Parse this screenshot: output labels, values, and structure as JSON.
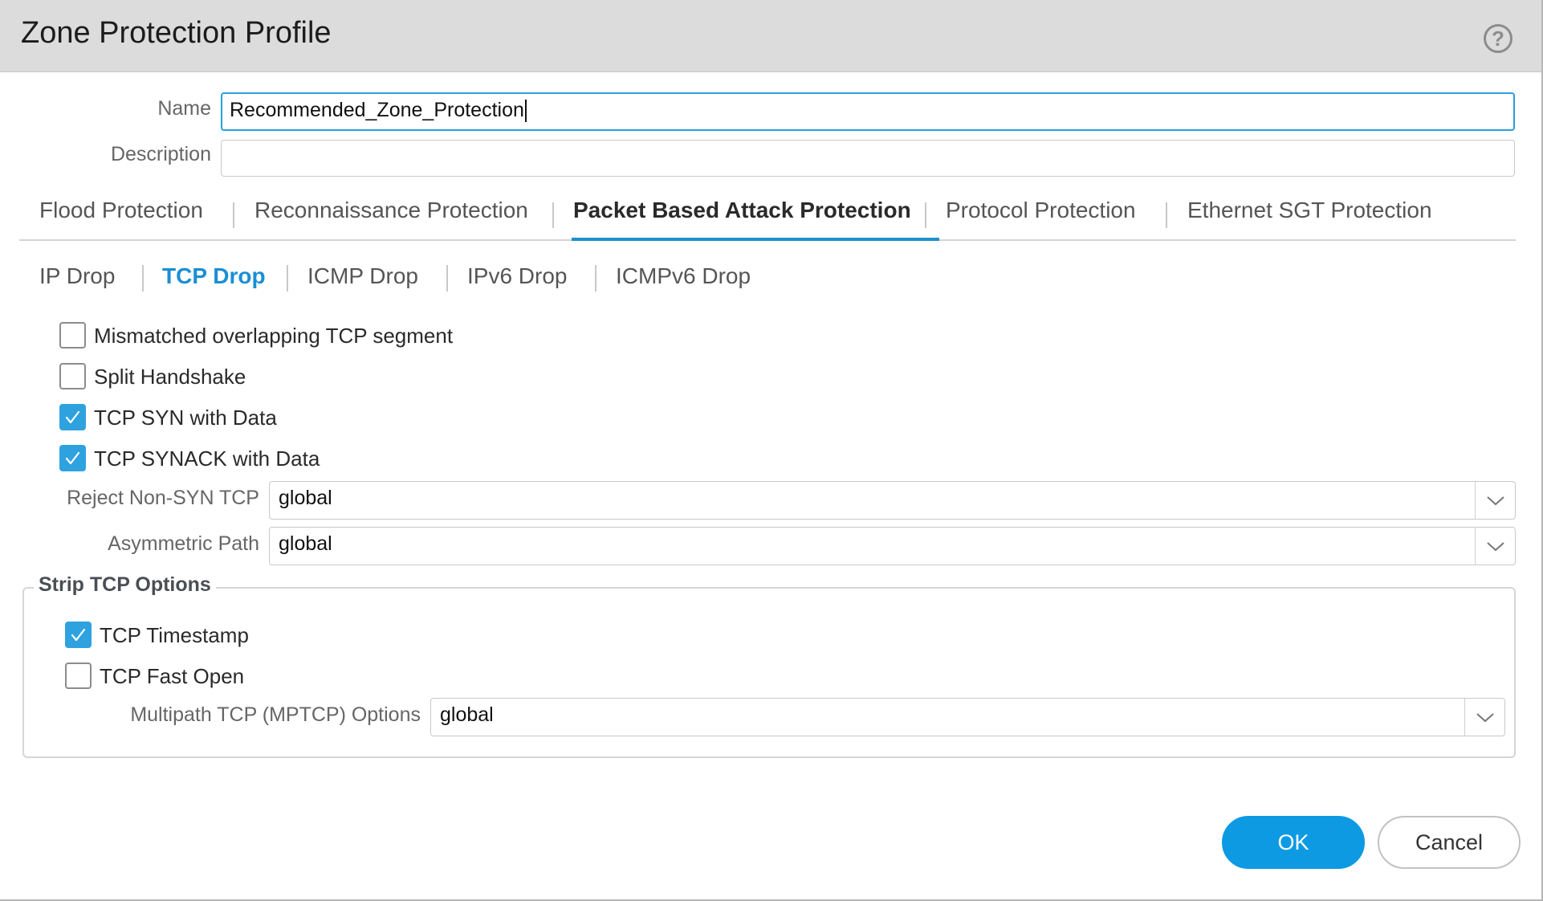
{
  "dialog": {
    "title": "Zone Protection Profile",
    "help_icon": "question-circle-icon"
  },
  "form": {
    "name_label": "Name",
    "name_value": "Recommended_Zone_Protection",
    "description_label": "Description",
    "description_value": ""
  },
  "main_tabs": [
    {
      "label": "Flood Protection",
      "active": false
    },
    {
      "label": "Reconnaissance Protection",
      "active": false
    },
    {
      "label": "Packet Based Attack Protection",
      "active": true
    },
    {
      "label": "Protocol Protection",
      "active": false
    },
    {
      "label": "Ethernet SGT Protection",
      "active": false
    }
  ],
  "sub_tabs": [
    {
      "label": "IP Drop",
      "active": false
    },
    {
      "label": "TCP Drop",
      "active": true
    },
    {
      "label": "ICMP Drop",
      "active": false
    },
    {
      "label": "IPv6 Drop",
      "active": false
    },
    {
      "label": "ICMPv6 Drop",
      "active": false
    }
  ],
  "tcp_drop": {
    "checkboxes": [
      {
        "label": "Mismatched overlapping TCP segment",
        "checked": false
      },
      {
        "label": "Split Handshake",
        "checked": false
      },
      {
        "label": "TCP SYN with Data",
        "checked": true
      },
      {
        "label": "TCP SYNACK with Data",
        "checked": true
      }
    ],
    "reject_non_syn_label": "Reject Non-SYN TCP",
    "reject_non_syn_value": "global",
    "asymmetric_path_label": "Asymmetric Path",
    "asymmetric_path_value": "global"
  },
  "strip_tcp_options": {
    "legend": "Strip TCP Options",
    "checkboxes": [
      {
        "label": "TCP Timestamp",
        "checked": true
      },
      {
        "label": "TCP Fast Open",
        "checked": false
      }
    ],
    "mptcp_label": "Multipath TCP (MPTCP) Options",
    "mptcp_value": "global"
  },
  "buttons": {
    "ok": "OK",
    "cancel": "Cancel"
  },
  "colors": {
    "accent": "#1a8fd3",
    "checkbox_checked": "#2ea2df",
    "ok_button": "#0d9ae3",
    "header_bg": "#dcdcdc"
  }
}
